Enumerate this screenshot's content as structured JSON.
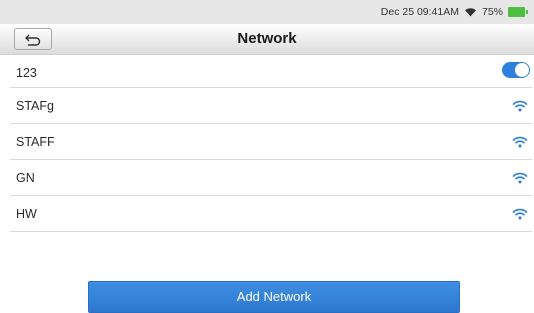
{
  "status_bar": {
    "datetime": "Dec 25 09:41AM",
    "battery": "75%"
  },
  "header": {
    "title": "Network"
  },
  "networks": [
    {
      "name": "123",
      "control": "toggle",
      "enabled": true
    },
    {
      "name": "STAFg",
      "control": "wifi-icon"
    },
    {
      "name": "STAFF",
      "control": "wifi-icon"
    },
    {
      "name": "GN",
      "control": "wifi-icon"
    },
    {
      "name": "HW",
      "control": "wifi-icon"
    }
  ],
  "actions": {
    "add_network_label": "Add Network"
  },
  "colors": {
    "accent": "#2f80de",
    "battery": "#4fbf43",
    "statusbar_bg": "#e7e7e7"
  },
  "icons": {
    "back": "back-arrow-icon",
    "wifi": "wifi-icon",
    "battery": "battery-icon",
    "status_wifi": "status-wifi-icon"
  }
}
